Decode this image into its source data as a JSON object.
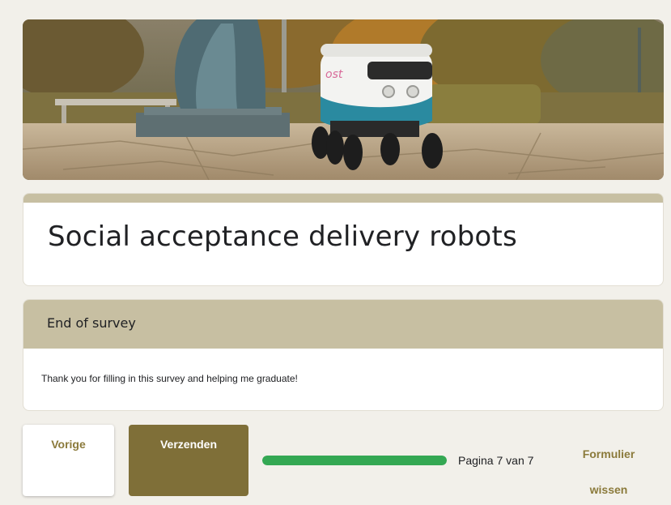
{
  "form": {
    "title": "Social acceptance delivery robots"
  },
  "section": {
    "title": "End of survey",
    "description": "Thank you for filling in this survey and helping me graduate!"
  },
  "navigation": {
    "back_label": "Vorige",
    "submit_label": "Verzenden",
    "progress_fraction": 1.0,
    "page_indicator": "Pagina 7 van 7",
    "clear_label_line1": "Formulier",
    "clear_label_line2": "wissen"
  },
  "colors": {
    "theme_accent": "#c7bfa2",
    "button_primary": "#7f6f38",
    "button_text": "#8b7a3b",
    "progress": "#34a853",
    "background": "#f2f0ea"
  },
  "icons": {
    "header": "delivery-robot-photo"
  }
}
